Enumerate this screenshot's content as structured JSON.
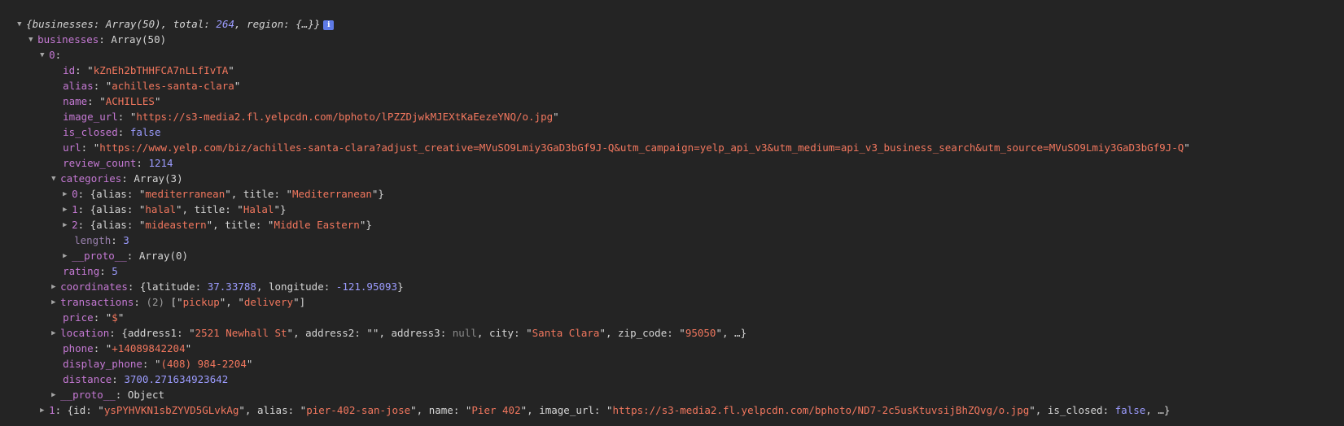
{
  "root": {
    "summary_prefix": "{",
    "businesses_key": "businesses",
    "businesses_preview": "Array(50)",
    "total_key": "total",
    "total_value": "264",
    "region_key": "region",
    "region_preview": "{…}",
    "summary_suffix": "}",
    "info_icon": "i"
  },
  "businesses": {
    "key": "businesses",
    "type": "Array(50)"
  },
  "item0": {
    "index": "0",
    "id_key": "id",
    "id": "kZnEh2bTHHFCA7nLLfIvTA",
    "alias_key": "alias",
    "alias": "achilles-santa-clara",
    "name_key": "name",
    "name": "ACHILLES",
    "image_url_key": "image_url",
    "image_url": "https://s3-media2.fl.yelpcdn.com/bphoto/lPZZDjwkMJEXtKaEezeYNQ/o.jpg",
    "is_closed_key": "is_closed",
    "is_closed": "false",
    "url_key": "url",
    "url": "https://www.yelp.com/biz/achilles-santa-clara?adjust_creative=MVuSO9Lmiy3GaD3bGf9J-Q&utm_campaign=yelp_api_v3&utm_medium=api_v3_business_search&utm_source=MVuSO9Lmiy3GaD3bGf9J-Q",
    "review_count_key": "review_count",
    "review_count": "1214",
    "categories_key": "categories",
    "categories_type": "Array(3)",
    "categories": [
      {
        "index": "0",
        "alias": "mediterranean",
        "title": "Mediterranean"
      },
      {
        "index": "1",
        "alias": "halal",
        "title": "Halal"
      },
      {
        "index": "2",
        "alias": "mideastern",
        "title": "Middle Eastern"
      }
    ],
    "categories_length_key": "length",
    "categories_length": "3",
    "proto_key": "__proto__",
    "categories_proto": "Array(0)",
    "rating_key": "rating",
    "rating": "5",
    "coordinates_key": "coordinates",
    "latitude": "37.33788",
    "longitude": "-121.95093",
    "transactions_key": "transactions",
    "transactions_count": "(2)",
    "transactions": [
      "pickup",
      "delivery"
    ],
    "price_key": "price",
    "price": "$",
    "location_key": "location",
    "address1": "2521 Newhall St",
    "address2": "",
    "address3": "null",
    "city": "Santa Clara",
    "zip_code": "95050",
    "phone_key": "phone",
    "phone": "+14089842204",
    "display_phone_key": "display_phone",
    "display_phone": "(408) 984-2204",
    "distance_key": "distance",
    "distance": "3700.271634923642",
    "item_proto": "Object"
  },
  "item1": {
    "index": "1",
    "id": "ysPYHVKN1sbZYVD5GLvkAg",
    "alias": "pier-402-san-jose",
    "name": "Pier 402",
    "image_url": "https://s3-media2.fl.yelpcdn.com/bphoto/ND7-2c5usKtuvsijBhZQvg/o.jpg",
    "is_closed": "false",
    "ellipsis": "…"
  },
  "labels": {
    "alias": "alias",
    "title": "title",
    "latitude": "latitude",
    "longitude": "longitude",
    "address1": "address1",
    "address2": "address2",
    "address3": "address3",
    "city": "city",
    "zip_code": "zip_code",
    "id": "id",
    "name": "name",
    "image_url": "image_url",
    "is_closed": "is_closed",
    "ellipsis": "…"
  }
}
